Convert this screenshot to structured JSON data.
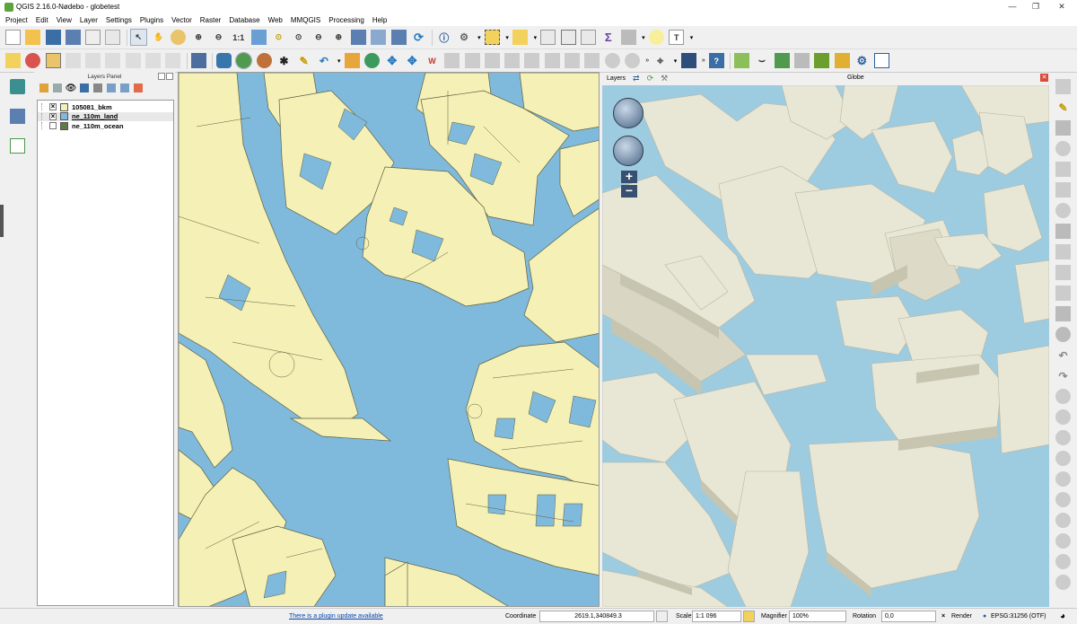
{
  "window": {
    "title": "QGIS 2.16.0-Nødebo - globetest"
  },
  "menu": [
    "Project",
    "Edit",
    "View",
    "Layer",
    "Settings",
    "Plugins",
    "Vector",
    "Raster",
    "Database",
    "Web",
    "MMQGIS",
    "Processing",
    "Help"
  ],
  "layers_panel": {
    "title": "Layers Panel",
    "layers": [
      {
        "name": "105081_bkm",
        "checked": true,
        "color": "#f4f0b6"
      },
      {
        "name": "ne_110m_land",
        "checked": true,
        "color": "#7fbadc"
      },
      {
        "name": "ne_110m_ocean",
        "checked": false,
        "color": "#5f7a46"
      }
    ]
  },
  "globe": {
    "layers_label": "Layers",
    "title": "Globe"
  },
  "status": {
    "plugin_update": "There is a plugin update available",
    "coordinate_label": "Coordinate",
    "coordinate_value": "2619.1,340849.3",
    "scale_label": "Scale",
    "scale_value": "1:1 096",
    "magnifier_label": "Magnifier",
    "magnifier_value": "100%",
    "rotation_label": "Rotation",
    "rotation_value": "0,0",
    "render_label": "Render",
    "crs": "EPSG:31256 (OTF)"
  },
  "colors": {
    "water": "#7fbadc",
    "land": "#f4f0b6",
    "building3d": "#e8e6d4"
  }
}
